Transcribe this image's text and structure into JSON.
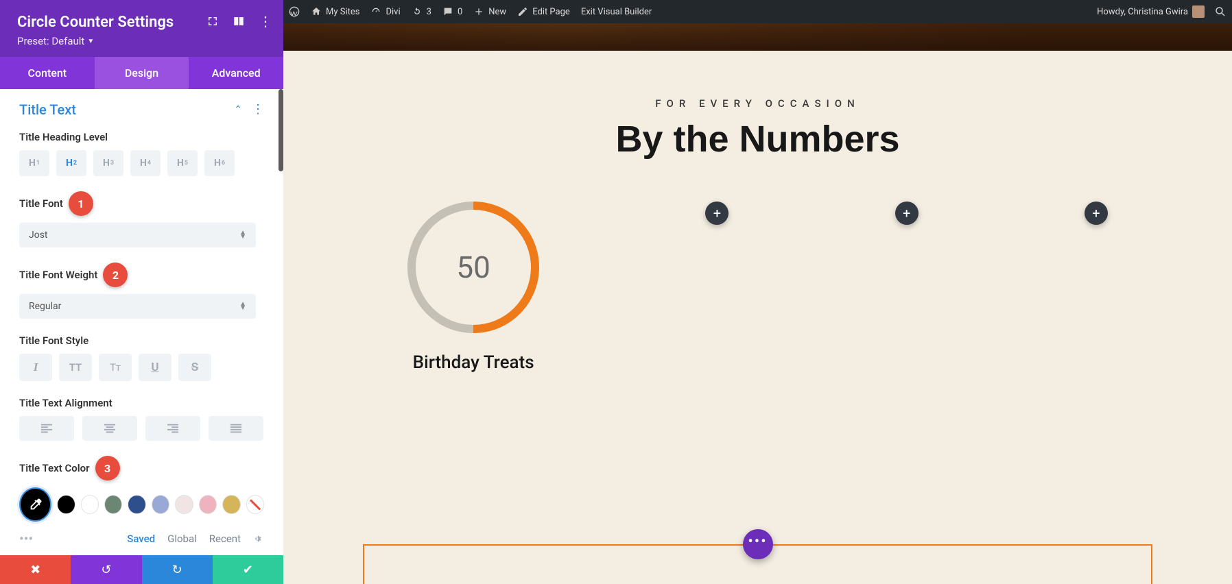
{
  "sidebar": {
    "title": "Circle Counter Settings",
    "preset": "Preset: Default",
    "tabs": {
      "content": "Content",
      "design": "Design",
      "advanced": "Advanced"
    },
    "section_title": "Title Text",
    "labels": {
      "heading_level": "Title Heading Level",
      "font": "Title Font",
      "font_weight": "Title Font Weight",
      "font_style": "Title Font Style",
      "alignment": "Title Text Alignment",
      "color": "Title Text Color"
    },
    "heading_levels": {
      "h1": "H",
      "h2": "H",
      "h3": "H",
      "h4": "H",
      "h5": "H",
      "h6": "H"
    },
    "font_value": "Jost",
    "font_weight_value": "Regular",
    "style_buttons": {
      "italic": "I",
      "uppercase": "TT",
      "smallcaps": "Tᴛ",
      "underline": "U",
      "strike": "S"
    },
    "swatch_colors": [
      "#000000",
      "#ffffff",
      "#6b8672",
      "#2d4f8b",
      "#9aa8d6",
      "#f1e4e4",
      "#eeb3be",
      "#d5b45a"
    ],
    "badges": {
      "one": "1",
      "two": "2",
      "three": "3"
    }
  },
  "preset_row": {
    "saved": "Saved",
    "global": "Global",
    "recent": "Recent"
  },
  "wpbar": {
    "my_sites": "My Sites",
    "divi": "Divi",
    "updates": "3",
    "comments": "0",
    "new": "New",
    "edit_page": "Edit Page",
    "exit_vb": "Exit Visual Builder",
    "howdy": "Howdy, Christina Gwira"
  },
  "page": {
    "subhead": "FOR EVERY OCCASION",
    "headline": "By the Numbers",
    "counter_value": "50",
    "counter_title": "Birthday Treats"
  }
}
